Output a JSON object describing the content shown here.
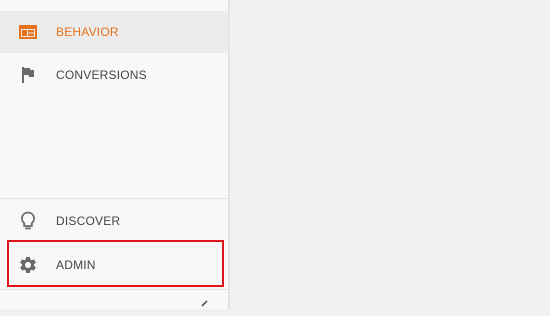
{
  "nav": {
    "items": [
      {
        "label": "BEHAVIOR",
        "icon": "behavior-icon",
        "active": true
      },
      {
        "label": "CONVERSIONS",
        "icon": "flag-icon",
        "active": false
      }
    ],
    "bottom": [
      {
        "label": "DISCOVER",
        "icon": "lightbulb-icon"
      },
      {
        "label": "ADMIN",
        "icon": "gear-icon"
      }
    ]
  },
  "colors": {
    "accent": "#e8711a",
    "highlight_border": "#e0141b",
    "text": "#444444",
    "sidebar_bg": "#f8f8f8",
    "main_bg": "#f1f1f1"
  },
  "collapse": {
    "icon": "chevron-left-icon"
  }
}
